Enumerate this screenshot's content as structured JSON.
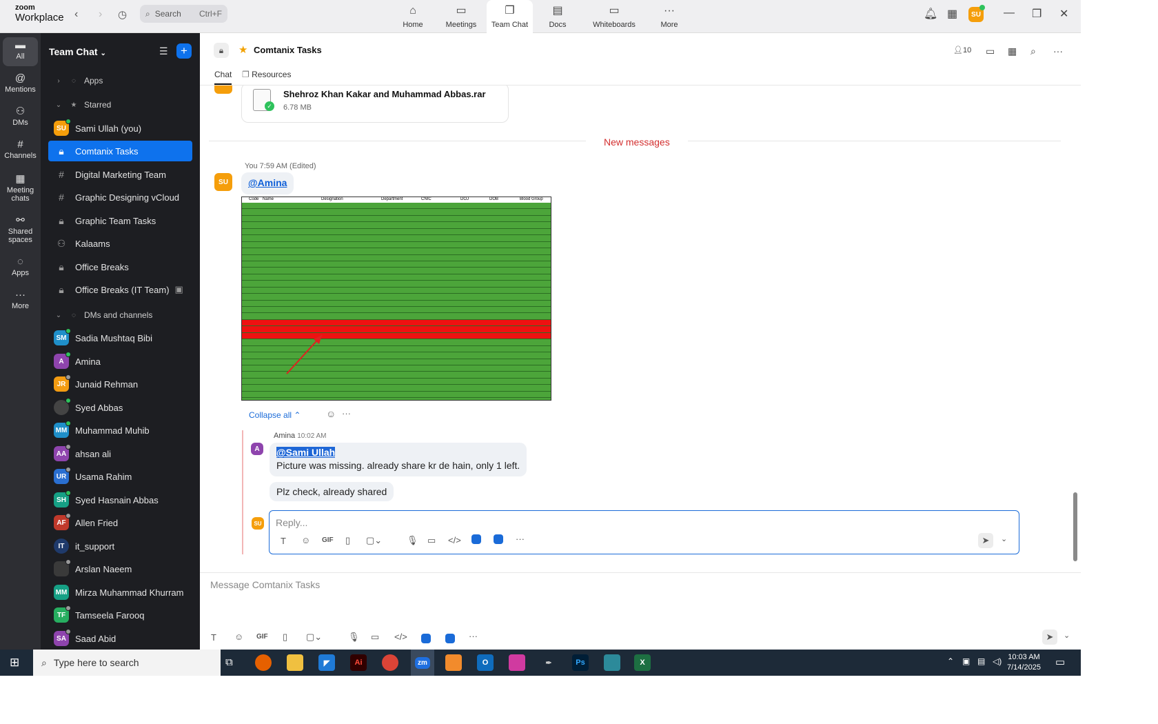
{
  "app": {
    "brand_line1": "zoom",
    "brand_line2": "Workplace"
  },
  "search": {
    "placeholder": "Search",
    "shortcut": "Ctrl+F"
  },
  "top_tabs": [
    {
      "label": "Home",
      "icon": "home-icon"
    },
    {
      "label": "Meetings",
      "icon": "video-icon"
    },
    {
      "label": "Team Chat",
      "icon": "chat-icon"
    },
    {
      "label": "Docs",
      "icon": "docs-icon"
    },
    {
      "label": "Whiteboards",
      "icon": "whiteboard-icon"
    },
    {
      "label": "More",
      "icon": "more-icon"
    }
  ],
  "user": {
    "initials": "SU",
    "color": "#f59e0b"
  },
  "rail": [
    {
      "label": "All",
      "icon": "chat-icon"
    },
    {
      "label": "Mentions",
      "icon": "at-icon"
    },
    {
      "label": "DMs",
      "icon": "people-icon"
    },
    {
      "label": "Channels",
      "icon": "hash-icon"
    },
    {
      "label": "Meeting chats",
      "icon": "calendar-icon"
    },
    {
      "label": "Shared spaces",
      "icon": "shared-icon"
    },
    {
      "label": "Apps",
      "icon": "apps-icon"
    },
    {
      "label": "More",
      "icon": "more-icon"
    }
  ],
  "sidebar": {
    "title": "Team Chat",
    "sections": {
      "apps": "Apps",
      "starred": "Starred",
      "dms": "DMs and channels"
    },
    "starred": [
      {
        "label": "Sami Ullah (you)",
        "initials": "SU",
        "color": "#f59e0b"
      },
      {
        "label": "Comtanix Tasks",
        "icon": "lock-icon"
      },
      {
        "label": "Digital Marketing Team",
        "icon": "hash-icon"
      },
      {
        "label": "Graphic Designing vCloud",
        "icon": "hash-icon"
      },
      {
        "label": "Graphic Team Tasks",
        "icon": "lock-icon"
      },
      {
        "label": "Kalaams",
        "icon": "people-icon"
      },
      {
        "label": "Office Breaks",
        "icon": "lock-icon"
      },
      {
        "label": "Office Breaks (IT Team)",
        "icon": "lock-icon"
      }
    ],
    "dms": [
      {
        "label": "Sadia Mushtaq Bibi",
        "initials": "SM",
        "color": "#1f8fc9"
      },
      {
        "label": "Amina",
        "initials": "A",
        "color": "#8e44ad"
      },
      {
        "label": "Junaid Rehman",
        "initials": "JR",
        "color": "#f39c12"
      },
      {
        "label": "Syed Abbas",
        "initials": "",
        "color": "#444"
      },
      {
        "label": "Muhammad Muhib",
        "initials": "MM",
        "color": "#1f8fc9"
      },
      {
        "label": "ahsan ali",
        "initials": "AA",
        "color": "#8e44ad"
      },
      {
        "label": "Usama Rahim",
        "initials": "UR",
        "color": "#2a6fd1"
      },
      {
        "label": "Syed Hasnain Abbas",
        "initials": "SH",
        "color": "#16a085"
      },
      {
        "label": "Allen Fried",
        "initials": "AF",
        "color": "#c0392b"
      },
      {
        "label": "it_support",
        "initials": "IT",
        "color": "#1f3a6b"
      },
      {
        "label": "Arslan Naeem",
        "initials": "",
        "color": "#3a3a3a"
      },
      {
        "label": "Mirza Muhammad Khurram",
        "initials": "MM",
        "color": "#16a085"
      },
      {
        "label": "Tamseela Farooq",
        "initials": "TF",
        "color": "#27ae60"
      },
      {
        "label": "Saad Abid",
        "initials": "SA",
        "color": "#8e44ad"
      }
    ]
  },
  "chat": {
    "title": "Comtanix Tasks",
    "members": "10",
    "tabs": [
      "Chat",
      "Resources"
    ],
    "file": {
      "name": "Shehroz Khan Kakar and Muhammad Abbas.rar",
      "size": "6.78 MB"
    },
    "new_messages": "New messages",
    "message": {
      "meta": "You 7:59 AM (Edited)",
      "mention": "@Amina"
    },
    "sheet_headers": [
      "Code",
      "Name",
      "Designation",
      "Department",
      "CNIC",
      "DOJ",
      "DOB",
      "Blood Group"
    ],
    "collapse": "Collapse all",
    "reply": {
      "author": "Amina",
      "time": "10:02 AM",
      "mention": "@Sami Ullah",
      "text": "Picture was missing. already share kr de hain, only 1 left.",
      "text2": "Plz check, already shared"
    },
    "reply_placeholder": "Reply...",
    "composer_placeholder": "Message Comtanix Tasks"
  },
  "taskbar": {
    "search": "Type here to search",
    "time": "10:03 AM",
    "date": "7/14/2025"
  }
}
